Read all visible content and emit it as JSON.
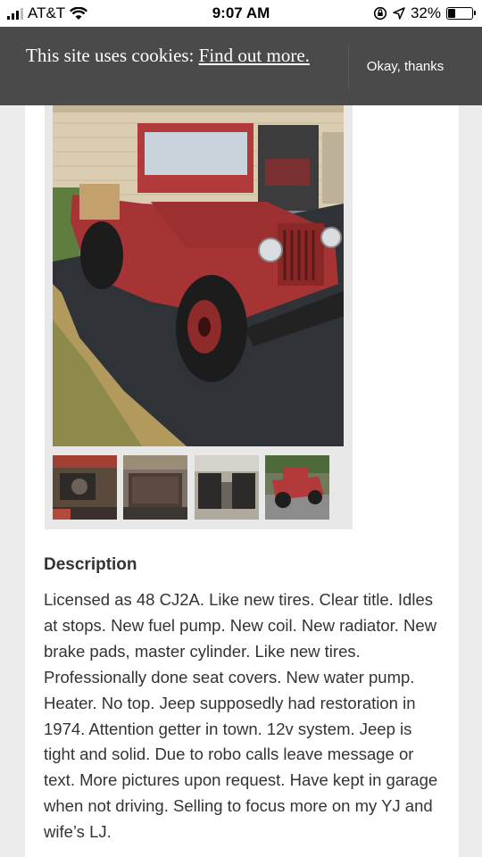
{
  "status_bar": {
    "carrier": "AT&T",
    "time": "9:07 AM",
    "battery": "32%",
    "battery_level": 0.32
  },
  "cookie_banner": {
    "text": "This site uses cookies: ",
    "link_label": "Find out more.",
    "accept_label": "Okay, thanks"
  },
  "gallery": {
    "thumbnails": [
      "engine-photo",
      "truck-bed-photo",
      "interior-photo",
      "jeep-side-photo"
    ]
  },
  "description": {
    "heading": "Description",
    "body": "Licensed as 48 CJ2A. Like new tires. Clear title. Idles at stops. New fuel pump. New coil. New radiator. New brake pads, master cylinder. Like new tires. Professionally done seat covers. New water pump. Heater. No top. Jeep supposedly had restoration in 1974. Attention getter in town. 12v system. Jeep is tight and solid. Due to robo calls leave message or text. More pictures upon request. Have kept in garage when not driving. Selling to focus more on my YJ and wife’s LJ."
  },
  "colors": {
    "banner_bg": "#4a4a4a",
    "jeep_red": "#b23a3a",
    "page_bg": "#ececec"
  }
}
